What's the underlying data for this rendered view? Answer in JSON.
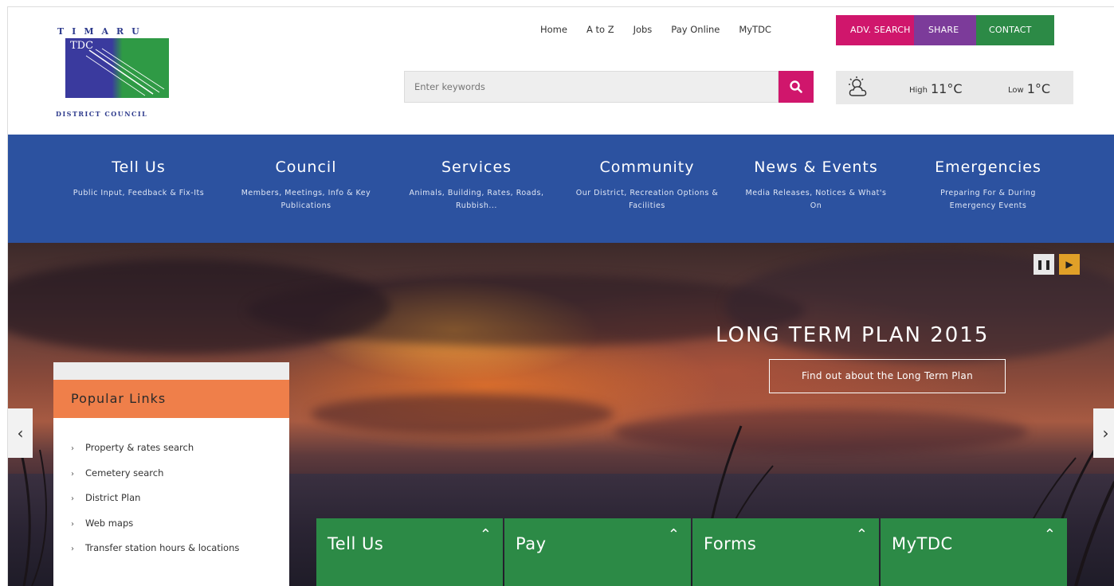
{
  "logo": {
    "top": "TIMARU",
    "inner": "TDC",
    "bottom": "DISTRICT COUNCIL"
  },
  "toplinks": [
    "Home",
    "A to Z",
    "Jobs",
    "Pay Online",
    "MyTDC"
  ],
  "topbuttons": {
    "adv_search": "ADV. SEARCH",
    "share": "SHARE",
    "contact": "CONTACT"
  },
  "search": {
    "placeholder": "Enter keywords"
  },
  "weather": {
    "icon": "cloud-sun-icon",
    "high_label": "High",
    "high": "11°C",
    "low_label": "Low",
    "low": "1°C"
  },
  "nav": [
    {
      "title": "Tell Us",
      "sub": "Public Input, Feedback & Fix-Its"
    },
    {
      "title": "Council",
      "sub": "Members, Meetings, Info & Key Publications"
    },
    {
      "title": "Services",
      "sub": "Animals, Building, Rates, Roads, Rubbish..."
    },
    {
      "title": "Community",
      "sub": "Our District, Recreation Options & Facilities"
    },
    {
      "title": "News & Events",
      "sub": "Media Releases, Notices & What's On"
    },
    {
      "title": "Emergencies",
      "sub": "Preparing For & During Emergency Events"
    }
  ],
  "hero": {
    "title": "LONG TERM PLAN 2015",
    "link": "Find out about the Long Term Plan"
  },
  "popular": {
    "heading": "Popular Links",
    "items": [
      "Property & rates search",
      "Cemetery search",
      "District Plan",
      "Web maps",
      "Transfer station hours & locations"
    ]
  },
  "tiles": [
    "Tell Us",
    "Pay",
    "Forms",
    "MyTDC"
  ],
  "colors": {
    "nav_blue": "#2c52a0",
    "magenta": "#d0166c",
    "purple": "#7c3b9a",
    "green": "#2c8a46",
    "orange": "#ef7f4a"
  }
}
